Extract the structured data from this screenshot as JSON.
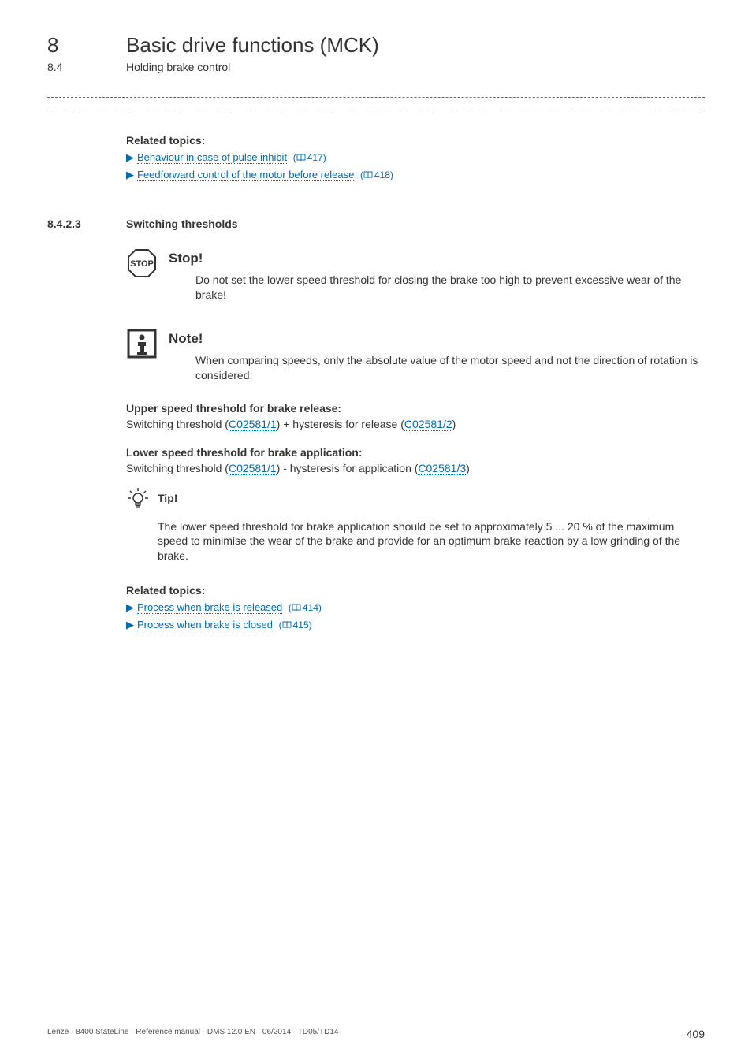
{
  "header": {
    "chapter_num": "8",
    "chapter_title": "Basic drive functions (MCK)",
    "section_num": "8.4",
    "section_title": "Holding brake control"
  },
  "related1": {
    "heading": "Related topics:",
    "items": [
      {
        "text": "Behaviour in case of pulse inhibit",
        "page": "417"
      },
      {
        "text": "Feedforward control of the motor before release",
        "page": "418"
      }
    ]
  },
  "subsection": {
    "num": "8.4.2.3",
    "title": "Switching thresholds"
  },
  "stop": {
    "title": "Stop!",
    "text": "Do not set the lower speed threshold for closing the brake too high to prevent excessive wear of the brake!"
  },
  "note": {
    "title": "Note!",
    "text": "When comparing speeds, only the absolute value of the motor speed and not the direction of rotation is considered."
  },
  "upper": {
    "heading": "Upper speed threshold for brake release:",
    "pre": "Switching threshold (",
    "link1": "C02581/1",
    "mid": ") + hysteresis for release (",
    "link2": "C02581/2",
    "post": ")"
  },
  "lower": {
    "heading": "Lower speed threshold for brake application:",
    "pre": "Switching threshold (",
    "link1": "C02581/1",
    "mid": ") - hysteresis for application (",
    "link2": "C02581/3",
    "post": ")"
  },
  "tip": {
    "title": "Tip!",
    "text": "The lower speed threshold for brake application should be set to approximately 5 ... 20 % of the maximum speed to minimise the wear of the brake and provide for an optimum brake reaction by a low grinding of the brake."
  },
  "related2": {
    "heading": "Related topics:",
    "items": [
      {
        "text": "Process when brake is released",
        "page": "414"
      },
      {
        "text": "Process when brake is closed",
        "page": "415"
      }
    ]
  },
  "footer": {
    "left": "Lenze · 8400 StateLine · Reference manual · DMS 12.0 EN · 06/2014 · TD05/TD14",
    "right": "409"
  }
}
